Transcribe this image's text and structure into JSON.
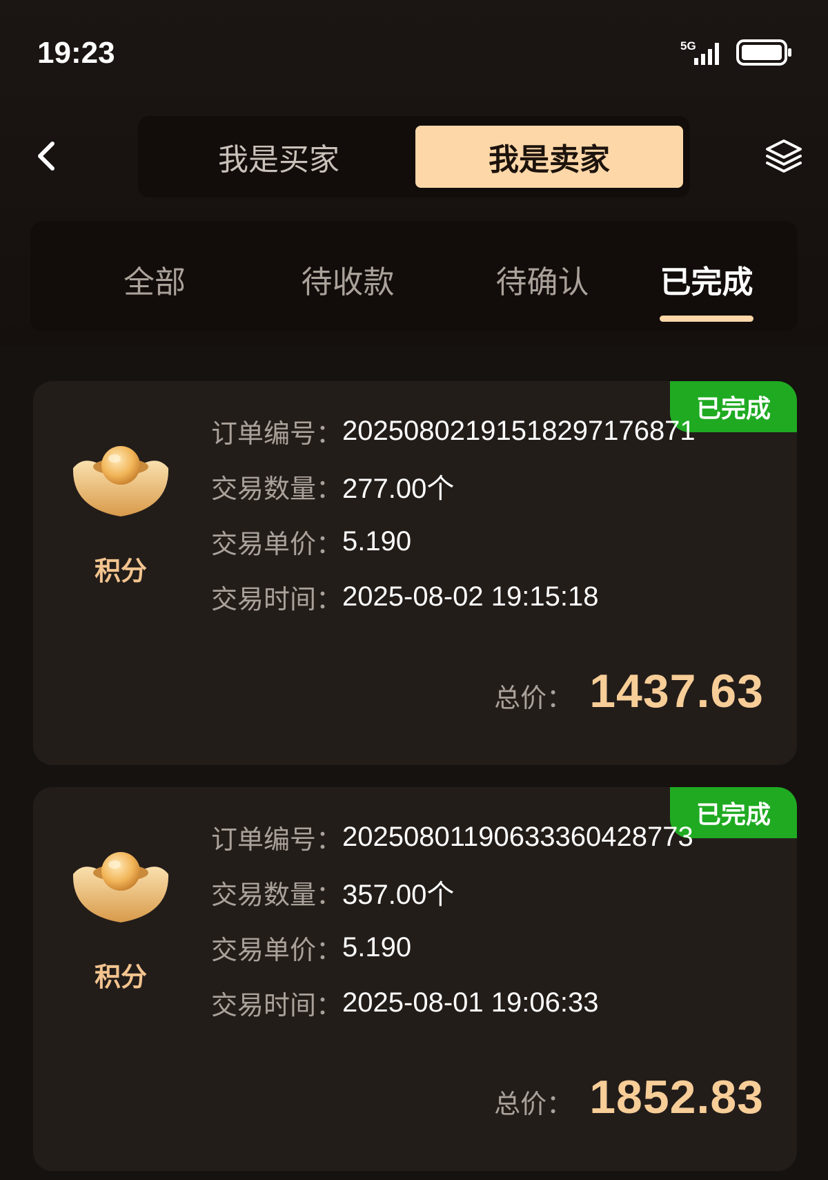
{
  "status_bar": {
    "time": "19:23",
    "network": "5G"
  },
  "header": {
    "buyer_tab": "我是买家",
    "seller_tab": "我是卖家",
    "active_role": "seller"
  },
  "status_tabs": [
    {
      "label": "全部",
      "active": false
    },
    {
      "label": "待收款",
      "active": false
    },
    {
      "label": "待确认",
      "active": false
    },
    {
      "label": "已完成",
      "active": true
    }
  ],
  "labels": {
    "order_no": "订单编号：",
    "quantity": "交易数量：",
    "unit_price": "交易单价：",
    "trade_time": "交易时间：",
    "total": "总价："
  },
  "orders": [
    {
      "status": "已完成",
      "asset": "积分",
      "order_no": "20250802191518297176871",
      "quantity": "277.00个",
      "unit_price": "5.190",
      "trade_time": "2025-08-02 19:15:18",
      "total": "1437.63"
    },
    {
      "status": "已完成",
      "asset": "积分",
      "order_no": "20250801190633360428773",
      "quantity": "357.00个",
      "unit_price": "5.190",
      "trade_time": "2025-08-01 19:06:33",
      "total": "1852.83"
    }
  ],
  "colors": {
    "accent": "#fdd7a8",
    "badge": "#1faa22",
    "total": "#f7cd98",
    "background": "#161210",
    "card": "#231d1a"
  }
}
